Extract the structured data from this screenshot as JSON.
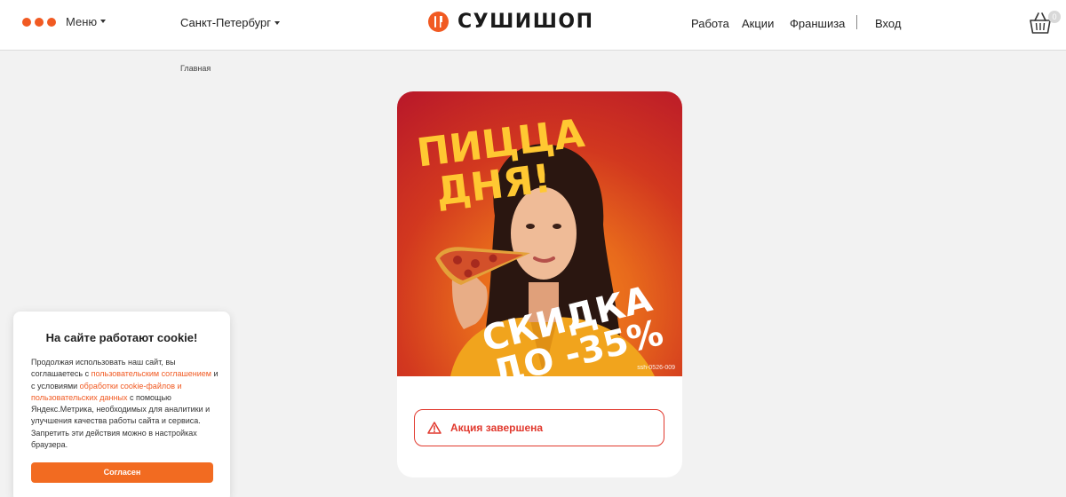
{
  "header": {
    "menu_label": "Меню",
    "city": "Санкт-Петербург",
    "logo_text": "СУШИШОП",
    "nav": [
      "Работа",
      "Акции",
      "Франшиза"
    ],
    "login": "Вход",
    "cart_count": "0"
  },
  "breadcrumb": {
    "home": "Главная"
  },
  "promo": {
    "headline_line1": "ПИЦЦА",
    "headline_line2": "ДНЯ!",
    "discount_line1": "СКИДКА",
    "discount_line2": "ДО -35%",
    "banner_code": "ssh-0526-009",
    "status": "Акция завершена"
  },
  "cookie": {
    "title": "На сайте работают cookie!",
    "text_1": "Продолжая использовать наш сайт, вы соглашаетесь с",
    "link_1": "пользовательским соглашением",
    "text_2": "и с условиями",
    "link_2": "обработки cookie-файлов и пользовательских данных",
    "text_3": "с помощью Яндекс.Метрика, необходимых для аналитики и улучшения качества работы сайта и сервиса. Запретить эти действия можно в настройках браузера.",
    "button": "Согласен"
  },
  "colors": {
    "accent": "#f15a22",
    "status_red": "#e1392e",
    "cookie_button": "#f26b21"
  },
  "icons": [
    "menu-dots-icon",
    "chevron-down-icon",
    "logo-icon",
    "cart-icon",
    "warning-icon"
  ]
}
